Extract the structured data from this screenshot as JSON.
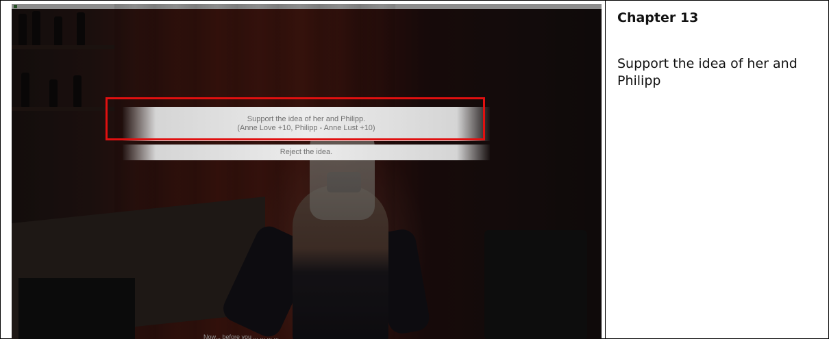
{
  "game": {
    "choices": [
      {
        "line1": "Support the idea of her and Philipp.",
        "line2": "(Anne Love +10, Philipp - Anne Lust +10)"
      },
      {
        "line1": "Reject the idea."
      }
    ],
    "dialogue_text": "Now... before you ... ... ... ..."
  },
  "annotation": {
    "chapter": "Chapter 13",
    "note": "Support the idea of her and Philipp",
    "highlight_color": "#e01010"
  }
}
